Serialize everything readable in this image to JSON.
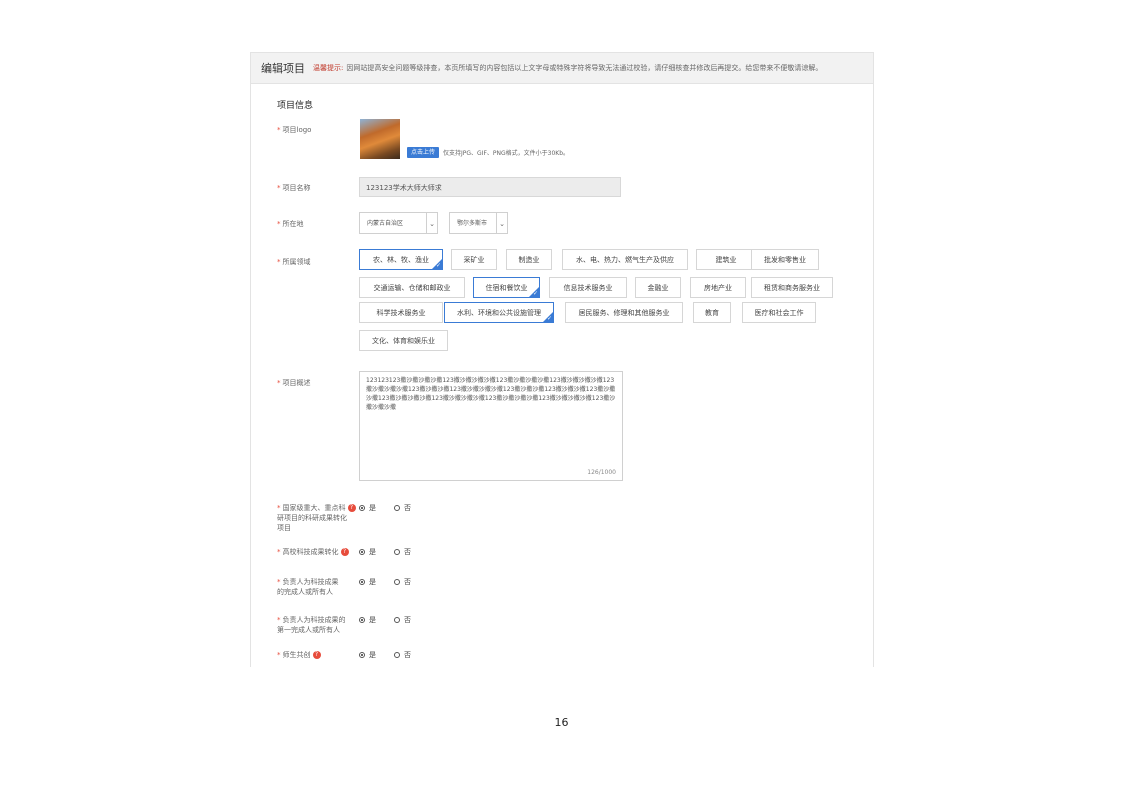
{
  "header": {
    "title": "编辑项目",
    "tip_label": "温馨提示:",
    "tip_text": "因网站提高安全问题等级排查，本页所填写的内容包括以上文字母或特殊字符将导致无法通过校验，请仔细核查并修改后再提交。给您带来不便敬请谅解。"
  },
  "section_title": "项目信息",
  "fields": {
    "logo_label": "项目logo",
    "upload_button": "点击上传",
    "upload_hint": "仅支持JPG、GIF、PNG格式，文件小于30Kb。",
    "name_label": "项目名称",
    "name_value": "123123学术大师大师求",
    "location_label": "所在地",
    "province": "内蒙古自治区",
    "city": "鄂尔多斯市",
    "industry_label": "所属领域",
    "description_label": "项目概述",
    "description_value": "123123123撒沙撒沙撒沙撒123撒沙撒沙撒沙撒123撒沙撒沙撒沙撒123撒沙撒沙撒沙撒123撒沙撒沙撒沙撒123撒沙撒沙撒123撒沙撒沙撒沙撒123撒沙撒沙撒123撒沙撒沙撒123撒沙撒沙撒123撒沙撒沙撒沙撒123撒沙撒沙撒沙撒123撒沙撒沙撒沙撒123撒沙撒沙撒沙撒123撒沙撒沙撒沙撒",
    "description_count": "126/1000"
  },
  "industries": [
    {
      "label": "农、林、牧、渔业",
      "selected": true
    },
    {
      "label": "采矿业",
      "selected": false
    },
    {
      "label": "制造业",
      "selected": false
    },
    {
      "label": "水、电、热力、燃气生产及供应",
      "selected": false
    },
    {
      "label": "建筑业",
      "selected": false
    },
    {
      "label": "批发和零售业",
      "selected": false
    },
    {
      "label": "交通运输、仓储和邮政业",
      "selected": false
    },
    {
      "label": "住宿和餐饮业",
      "selected": true
    },
    {
      "label": "信息技术服务业",
      "selected": false
    },
    {
      "label": "金融业",
      "selected": false
    },
    {
      "label": "房地产业",
      "selected": false
    },
    {
      "label": "租赁和商务服务业",
      "selected": false
    },
    {
      "label": "科学技术服务业",
      "selected": false
    },
    {
      "label": "水利、环境和公共设施管理",
      "selected": true
    },
    {
      "label": "居民服务、修理和其他服务业",
      "selected": false
    },
    {
      "label": "教育",
      "selected": false
    },
    {
      "label": "医疗和社会工作",
      "selected": false
    },
    {
      "label": "文化、体育和娱乐业",
      "selected": false
    }
  ],
  "questions": [
    {
      "label_line1": "国家级重大、重点科",
      "label_line2": "研项目的科研成果转化",
      "label_line3": "项目",
      "help": true,
      "yes": "是",
      "no": "否",
      "selected": "yes"
    },
    {
      "label_line1": "高校科技成果转化",
      "label_line2": "",
      "label_line3": "",
      "help": true,
      "yes": "是",
      "no": "否",
      "selected": "yes"
    },
    {
      "label_line1": "负责人为科技成果",
      "label_line2": "的完成人或所有人",
      "label_line3": "",
      "help": false,
      "yes": "是",
      "no": "否",
      "selected": "yes"
    },
    {
      "label_line1": "负责人为科技成果的",
      "label_line2": "第一完成人或所有人",
      "label_line3": "",
      "help": false,
      "yes": "是",
      "no": "否",
      "selected": "yes"
    },
    {
      "label_line1": "师生共创",
      "label_line2": "",
      "label_line3": "",
      "help": true,
      "yes": "是",
      "no": "否",
      "selected": "yes"
    }
  ],
  "help_glyph": "?",
  "required_mark": "*",
  "page_number": "16",
  "colors": {
    "accent": "#3a7bd5",
    "required": "#e74c3c"
  }
}
